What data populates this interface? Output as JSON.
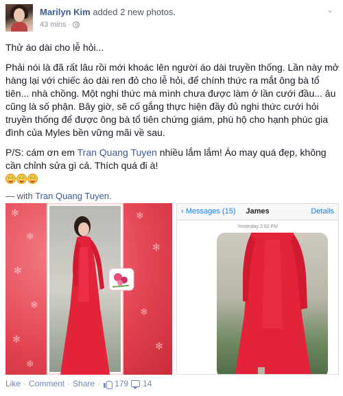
{
  "post": {
    "author": "Marilyn Kim",
    "action": "added 2 new photos.",
    "time": "43 mins",
    "separator": "·",
    "paragraphs": [
      "Thử áo dài cho lễ hỏi...",
      "Phải nói là đã rất lâu rồi mới khoác lên người áo dài truyền thống. Lần này mở hàng lại với chiếc áo dài ren đỏ cho lễ hỏi, để chính thức ra mắt ông bà tổ tiên... nhà chồng. Một nghi thức mà mình chưa được làm ở lần cưới đầu... âu cũng là số phận. Bây giờ, sẽ cố gắng thực hiện đầy đủ nghi thức cưới hỏi truyền thống để được ông bà tổ tiên chứng giám, phù hộ cho hạnh phúc gia đình của Myles bền vững mãi về sau."
    ],
    "ps_before": "P/S: cám ơn em ",
    "ps_link": "Tran Quang Tuyen",
    "ps_after": " nhiều lắm lắm! Áo may quá đẹp, không cần chỉnh sửa gì cả. Thích quá đi à!",
    "with_prefix": "— with ",
    "with_link": "Tran Quang Tuyen",
    "with_suffix": "."
  },
  "photo2": {
    "back_label": "Messages (15)",
    "contact": "James",
    "details": "Details",
    "timestamp": "Yesterday 2:50 PM"
  },
  "actions": {
    "like": "Like",
    "comment": "Comment",
    "share": "Share",
    "dot": "·",
    "like_count": "179",
    "comment_count": "14"
  },
  "colors": {
    "link": "#3b5998",
    "dress": "#e2233a",
    "frame_bg": "#e2424f"
  },
  "icons": [
    "globe-icon",
    "chevron-down-icon",
    "emoji-grin-icon",
    "like-thumb-icon",
    "comment-bubble-icon",
    "chevron-left-icon"
  ]
}
